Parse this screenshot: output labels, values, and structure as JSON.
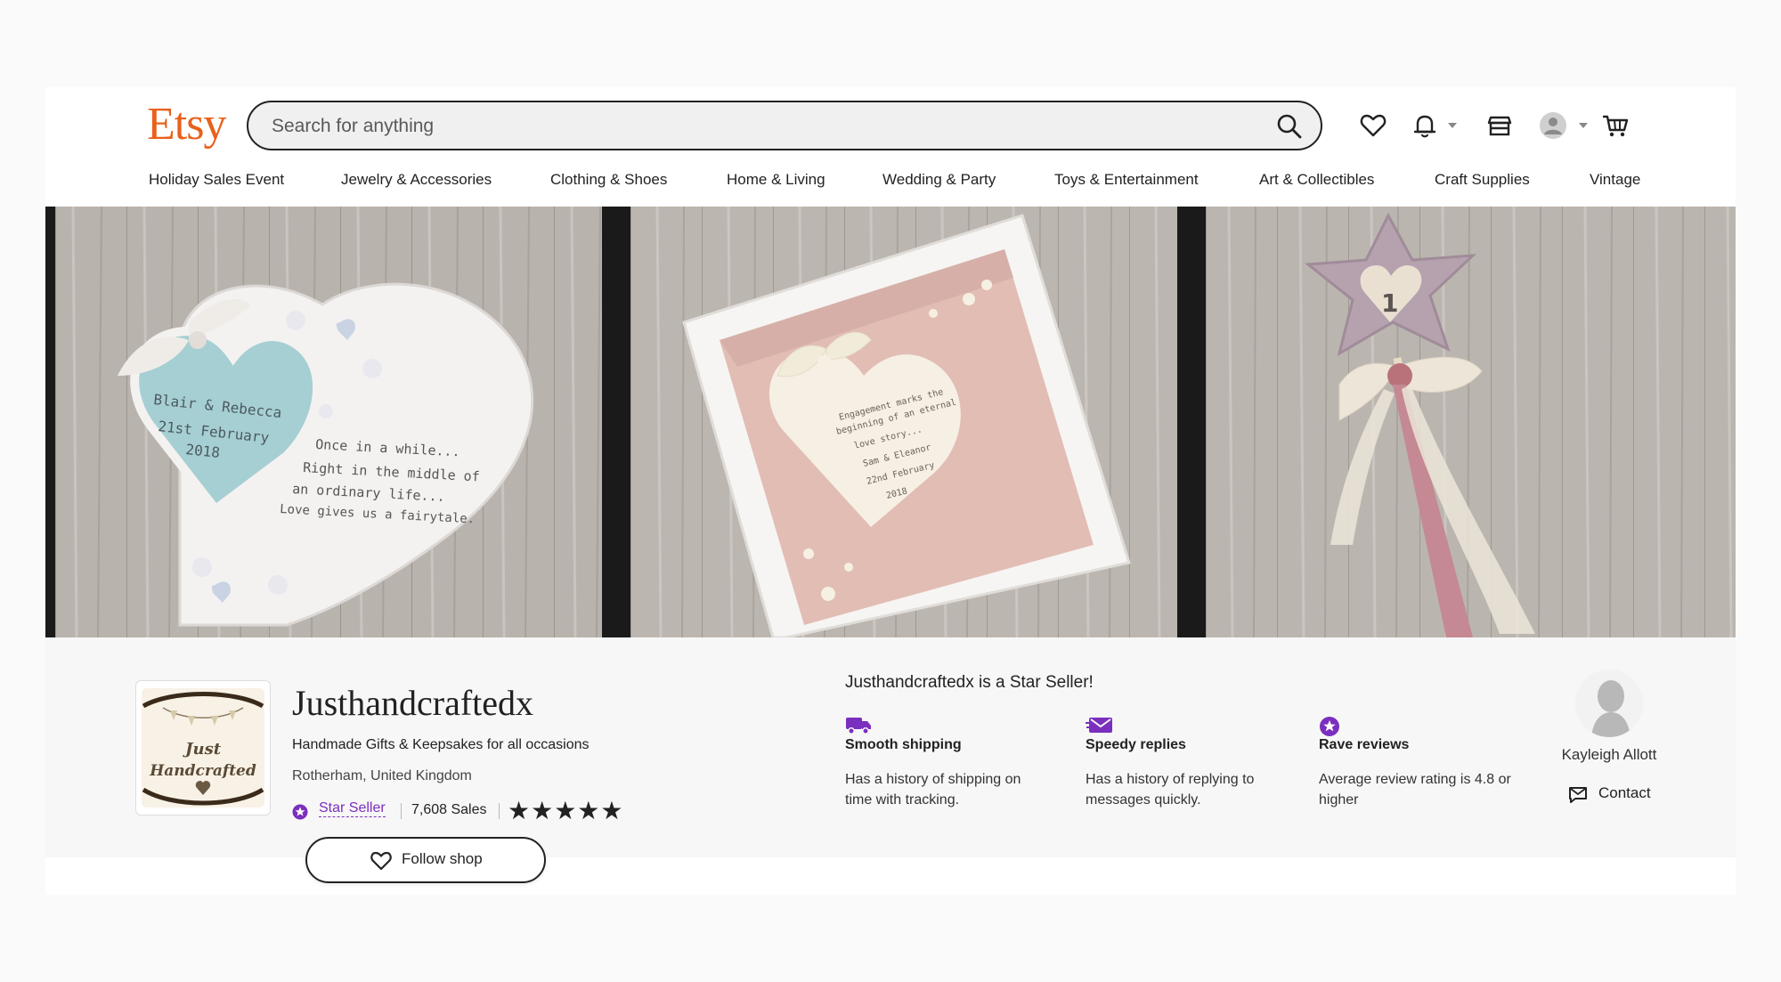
{
  "header": {
    "logo": "Etsy",
    "search_placeholder": "Search for anything"
  },
  "nav": {
    "items": [
      "Holiday Sales Event",
      "Jewelry & Accessories",
      "Clothing & Shoes",
      "Home & Living",
      "Wedding & Party",
      "Toys & Entertainment",
      "Art & Collectibles",
      "Craft Supplies",
      "Vintage"
    ]
  },
  "banner": {
    "panel1": {
      "names": "Blair & Rebecca",
      "date": "21st February",
      "year": "2018",
      "quote": [
        "Once in a while...",
        "Right in the middle of",
        "an ordinary life...",
        "Love gives us a fairytale."
      ]
    },
    "panel2": {
      "lines": [
        "Engagement marks the",
        "beginning of an eternal",
        "love story...",
        "Sam & Eleanor",
        "22nd February",
        "2018"
      ]
    },
    "panel3": {
      "number": "1"
    }
  },
  "shop": {
    "logo_text": [
      "Just",
      "Handcrafted"
    ],
    "name": "Justhandcraftedx",
    "tagline": "Handmade Gifts & Keepsakes for all occasions",
    "location": "Rotherham, United Kingdom",
    "star_seller_label": "Star Seller",
    "sales": "7,608 Sales",
    "stars": "★★★★★",
    "follow_label": "Follow shop"
  },
  "star_seller": {
    "title": "Justhandcraftedx is a Star Seller!",
    "features": [
      {
        "icon": "truck-icon",
        "title": "Smooth shipping",
        "desc": "Has a history of shipping on time with tracking."
      },
      {
        "icon": "envelope-icon",
        "title": "Speedy replies",
        "desc": "Has a history of replying to messages quickly."
      },
      {
        "icon": "star-badge-icon",
        "title": "Rave reviews",
        "desc": "Average review rating is 4.8 or higher"
      }
    ]
  },
  "owner": {
    "name": "Kayleigh Allott",
    "contact_label": "Contact"
  },
  "colors": {
    "brand": "#e8611a",
    "star_seller": "#7b2fbe"
  }
}
